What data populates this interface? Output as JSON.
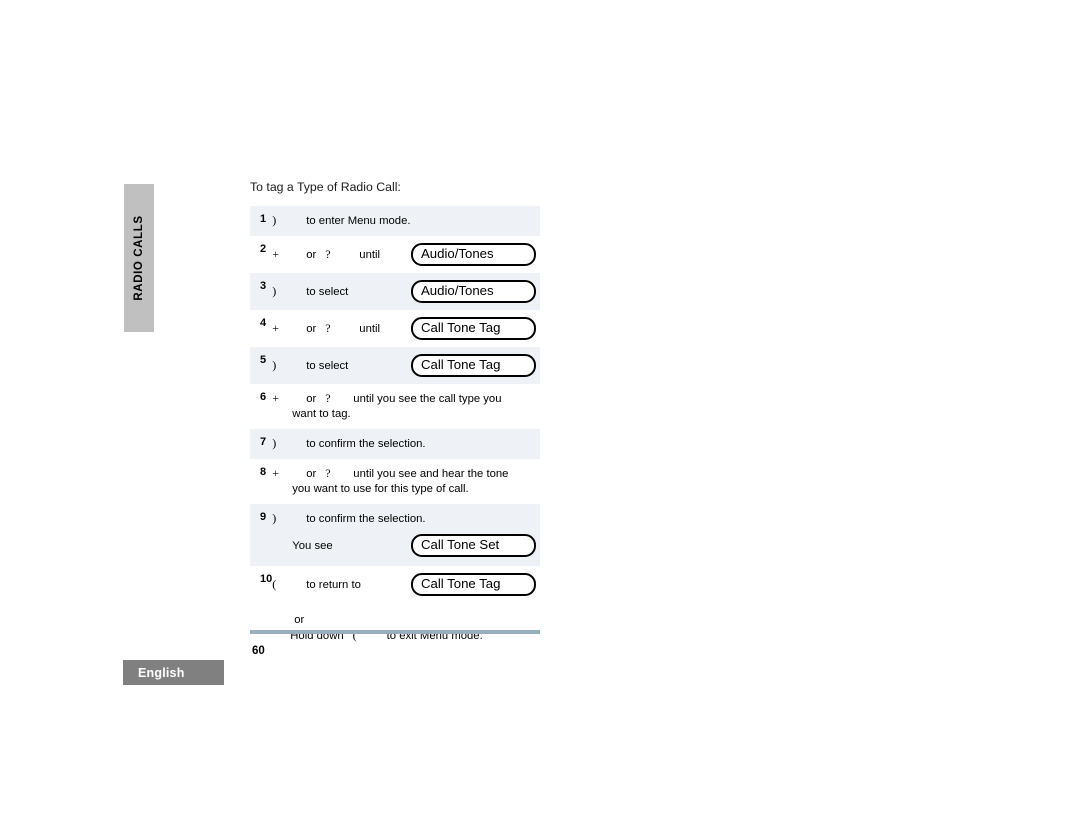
{
  "section_tab": {
    "label": "RADIO CALLS",
    "bg_color": "#c0c0c0"
  },
  "language_tab": {
    "label": "English",
    "bg_color": "#808080",
    "text_color": "#ffffff"
  },
  "procedure": {
    "title": "To tag a Type of Radio Call:"
  },
  "colors": {
    "shaded_row": "#eef2f6",
    "plain_row": "#ffffff",
    "rule": "#97aebc",
    "box_border": "#000000"
  },
  "steps": [
    {
      "number": "1",
      "symbol": ")",
      "text": "to enter Menu mode.",
      "shaded": true
    },
    {
      "number": "2",
      "symbol": "+",
      "connector": "or",
      "symbol2": "?",
      "suffix": "until",
      "display": "Audio/Tones",
      "shaded": false
    },
    {
      "number": "3",
      "symbol": ")",
      "text": "to select",
      "display": "Audio/Tones",
      "shaded": true
    },
    {
      "number": "4",
      "symbol": "+",
      "connector": "or",
      "symbol2": "?",
      "suffix": "until",
      "display": "Call Tone Tag",
      "shaded": false
    },
    {
      "number": "5",
      "symbol": ")",
      "text": "to select",
      "display": "Call Tone Tag",
      "shaded": true
    },
    {
      "number": "6",
      "symbol": "+",
      "connector": "or",
      "symbol2": "?",
      "suffix": "until you see the call type you",
      "wrap": "want to tag.",
      "shaded": false
    },
    {
      "number": "7",
      "symbol": ")",
      "text": "to confirm the selection.",
      "shaded": true
    },
    {
      "number": "8",
      "symbol": "+",
      "connector": "or",
      "symbol2": "?",
      "suffix": "until you see and hear the tone",
      "wrap": "you want to use for this type of call.",
      "shaded": false
    },
    {
      "number": "9",
      "symbol": ")",
      "text": "to confirm the selection.",
      "subline_label": "You see",
      "subline_display": "Call Tone Set",
      "shaded": true
    },
    {
      "number": "10",
      "symbol": "(",
      "text": "to return to",
      "display": "Call Tone Tag",
      "shaded": false,
      "tail_or": "or",
      "tail_hold_prefix": "Hold down",
      "tail_hold_symbol": "(",
      "tail_hold_suffix": "to exit Menu mode."
    }
  ],
  "footer": {
    "page_number": "60"
  }
}
